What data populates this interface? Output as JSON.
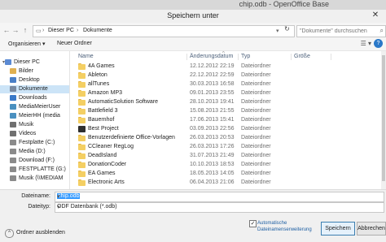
{
  "window": {
    "background_title": "chip.odb - OpenOffice Base",
    "title": "Speichern unter",
    "close_glyph": "✕"
  },
  "address": {
    "back_glyph": "←",
    "forward_glyph": "→",
    "up_glyph": "↑",
    "path": [
      "Dieser PC",
      "Dokumente"
    ],
    "separator": "›",
    "search_placeholder": "\"Dokumente\" durchsuchen"
  },
  "toolbar": {
    "organize_label": "Organisieren ▾",
    "new_folder_label": "Neuer Ordner",
    "view_glyph": "☰ ▾",
    "help_glyph": "?"
  },
  "nav": {
    "items": [
      {
        "label": "Dieser PC",
        "icon": "computer-icon",
        "color": "#5b8ad3",
        "indent": 0,
        "expanded": true
      },
      {
        "label": "Bilder",
        "icon": "pictures-icon",
        "color": "#e0b050",
        "indent": 1
      },
      {
        "label": "Desktop",
        "icon": "desktop-icon",
        "color": "#4a7fc6",
        "indent": 1
      },
      {
        "label": "Dokumente",
        "icon": "documents-icon",
        "color": "#7a8aa0",
        "indent": 1,
        "selected": true
      },
      {
        "label": "Downloads",
        "icon": "downloads-icon",
        "color": "#3a79c8",
        "indent": 1
      },
      {
        "label": "MediaMeierUser",
        "icon": "media-server-icon",
        "color": "#4a90c0",
        "indent": 1
      },
      {
        "label": "MeierHH (media",
        "icon": "media-server-icon",
        "color": "#4a90c0",
        "indent": 1
      },
      {
        "label": "Musik",
        "icon": "music-icon",
        "color": "#6f6f6f",
        "indent": 1
      },
      {
        "label": "Videos",
        "icon": "videos-icon",
        "color": "#6f6f6f",
        "indent": 1
      },
      {
        "label": "Festplatte (C:)",
        "icon": "drive-icon",
        "color": "#8a8a8a",
        "indent": 1
      },
      {
        "label": "Media (D:)",
        "icon": "drive-icon",
        "color": "#8a8a8a",
        "indent": 1
      },
      {
        "label": "Download (F:)",
        "icon": "drive-icon",
        "color": "#8a8a8a",
        "indent": 1
      },
      {
        "label": "FESTPLATTE (G:)",
        "icon": "drive-icon",
        "color": "#8a8a8a",
        "indent": 1
      },
      {
        "label": "Musik (\\\\MEDIAM",
        "icon": "network-drive-icon",
        "color": "#8a8a8a",
        "indent": 1
      }
    ]
  },
  "columns": {
    "name": "Name",
    "date": "Änderungsdatum",
    "type": "Typ",
    "size": "Größe",
    "sort_glyph": "^"
  },
  "files": [
    {
      "name": "4A Games",
      "date": "12.12.2012 22:19",
      "type": "Dateiordner",
      "icon": "folder-icon"
    },
    {
      "name": "Ableton",
      "date": "22.12.2012 22:59",
      "type": "Dateiordner",
      "icon": "folder-icon"
    },
    {
      "name": "allTunes",
      "date": "30.03.2013 16:58",
      "type": "Dateiordner",
      "icon": "folder-icon"
    },
    {
      "name": "Amazon MP3",
      "date": "09.01.2013 23:55",
      "type": "Dateiordner",
      "icon": "folder-icon"
    },
    {
      "name": "AutomaticSolution Software",
      "date": "28.10.2013 19:41",
      "type": "Dateiordner",
      "icon": "folder-icon"
    },
    {
      "name": "Battlefield 3",
      "date": "15.08.2013 21:55",
      "type": "Dateiordner",
      "icon": "folder-icon"
    },
    {
      "name": "Bauernhof",
      "date": "17.06.2013 15:41",
      "type": "Dateiordner",
      "icon": "folder-icon"
    },
    {
      "name": "Best Project",
      "date": "03.09.2013 22:56",
      "type": "Dateiordner",
      "icon": "project-folder-icon"
    },
    {
      "name": "Benutzerdefinierte Office-Vorlagen",
      "date": "26.03.2013 20:53",
      "type": "Dateiordner",
      "icon": "folder-icon"
    },
    {
      "name": "CCleaner RegLog",
      "date": "26.03.2013 17:26",
      "type": "Dateiordner",
      "icon": "folder-icon"
    },
    {
      "name": "DeadIsland",
      "date": "31.07.2013 21:49",
      "type": "Dateiordner",
      "icon": "folder-icon"
    },
    {
      "name": "DonationCoder",
      "date": "10.10.2013 18:53",
      "type": "Dateiordner",
      "icon": "folder-icon"
    },
    {
      "name": "EA Games",
      "date": "18.05.2013 14:05",
      "type": "Dateiordner",
      "icon": "folder-icon"
    },
    {
      "name": "Electronic Arts",
      "date": "06.04.2013 21:06",
      "type": "Dateiordner",
      "icon": "folder-icon"
    }
  ],
  "form": {
    "filename_label": "Dateiname:",
    "filename_value": "chip.odb",
    "filetype_label": "Dateityp:",
    "filetype_value": "ODF Datenbank (*.odb)",
    "dropdown_glyph": "▾",
    "auto_ext_label": "Automatische Dateinamenserweiterung",
    "auto_ext_checked": "✓",
    "hide_folders_label": "Ordner ausblenden",
    "hide_folders_glyph": "^",
    "save_label": "Speichern",
    "cancel_label": "Abbrechen"
  }
}
